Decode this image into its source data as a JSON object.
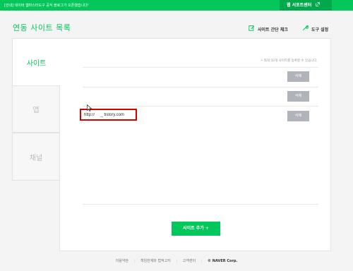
{
  "topbar": {
    "notice": "[안내] 네이버 웹마스터도구 공식 블로그가 오픈했습니다!",
    "support_label": "웹 서포트센터",
    "support_icon": "external-link-icon"
  },
  "header": {
    "title": "연동 사이트 목록",
    "check_label": "사이트 간단 체크",
    "check_icon": "edit-icon",
    "tools_label": "도구 설정",
    "tools_icon": "wrench-icon"
  },
  "tabs": [
    {
      "label": "사이트",
      "active": true
    },
    {
      "label": "앱",
      "active": false
    },
    {
      "label": "채널",
      "active": false
    }
  ],
  "panel": {
    "helper": "• 최대 50개 사이트를 등록할 수 있습니다.",
    "delete_label": "삭제",
    "url_value": "http://     _ tistory.com",
    "add_button": "사이트 추가 +"
  },
  "footer": {
    "links": [
      "이용약관",
      "책임한계와 법적고지",
      "고객센터"
    ],
    "brand": "© NAVER Corp."
  },
  "colors": {
    "accent": "#03c75a",
    "highlight_border": "#d50000",
    "delete_button": "#b0b4ba"
  }
}
